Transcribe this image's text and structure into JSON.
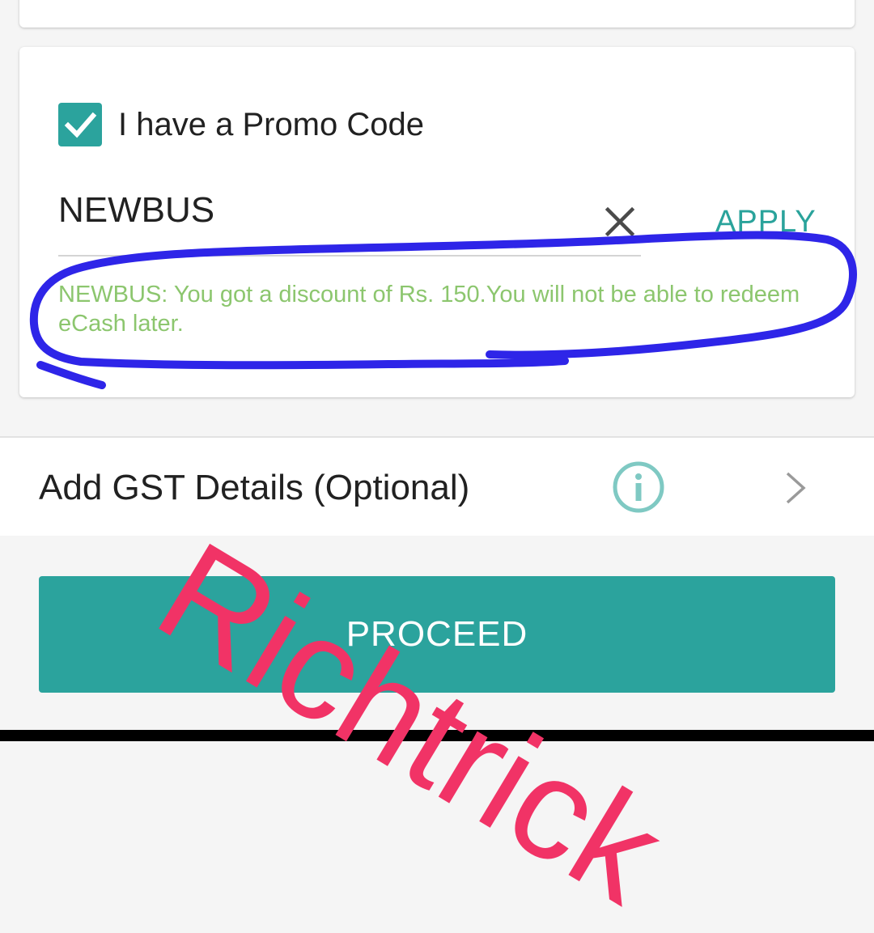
{
  "promo": {
    "checkbox_label": "I have a Promo Code",
    "checked": true,
    "code_value": "NEWBUS",
    "apply_label": "APPLY",
    "message": "NEWBUS: You got a discount of Rs. 150.You will not be able to redeem eCash later."
  },
  "gst": {
    "label": "Add GST Details (Optional)"
  },
  "icons": {
    "checkbox": "check-icon",
    "clear": "close-icon",
    "info": "info-icon",
    "chevron": "chevron-right-icon"
  },
  "proceed": {
    "label": "PROCEED"
  },
  "watermark": {
    "text": "Richtrick"
  },
  "colors": {
    "accent": "#2ba39d",
    "message": "#8cc66e",
    "annotation_circle": "#2e25e8",
    "watermark": "#f13366"
  }
}
